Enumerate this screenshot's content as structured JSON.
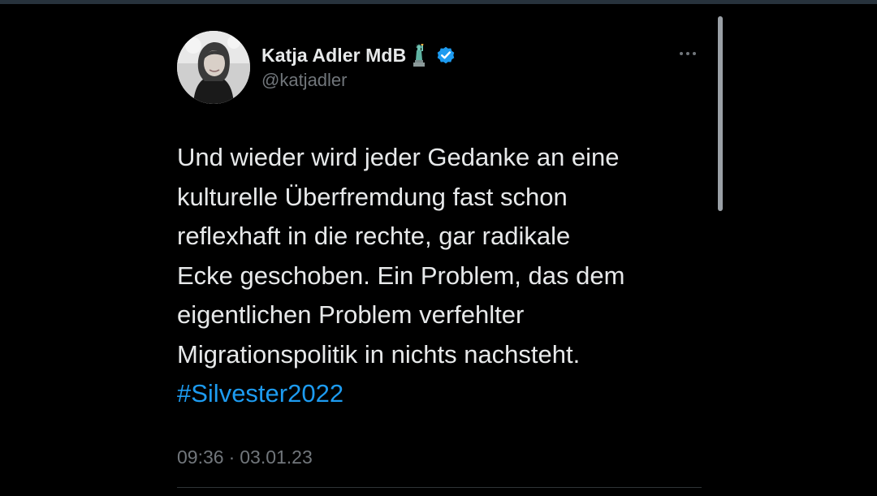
{
  "author": {
    "display_name": "Katja Adler MdB",
    "handle": "@katjadler",
    "emoji": "statue-of-liberty-icon",
    "verified": true
  },
  "tweet": {
    "lines": [
      "Und wieder wird jeder Gedanke an eine",
      "kulturelle Überfremdung fast schon",
      "reflexhaft in die rechte, gar radikale",
      "Ecke geschoben. Ein Problem, das dem",
      "eigentlichen Problem verfehlter",
      "Migrationspolitik in nichts nachsteht."
    ],
    "hashtag": "#Silvester2022",
    "time": "09:36",
    "separator": "·",
    "date": "03.01.23"
  },
  "colors": {
    "background": "#000000",
    "text": "#e7e9ea",
    "muted": "#71767b",
    "link": "#1d9bf0",
    "verified": "#1d9bf0"
  },
  "icons": {
    "more": "more-horizontal-icon",
    "verified": "verified-badge-icon"
  }
}
